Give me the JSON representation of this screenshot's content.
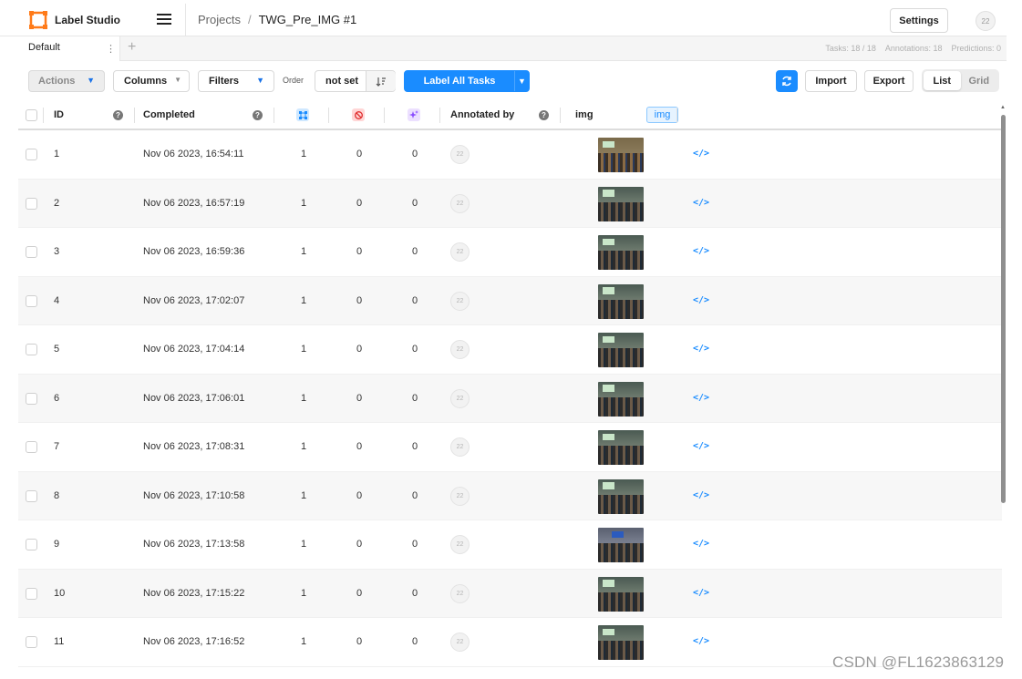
{
  "header": {
    "app_name": "Label Studio",
    "breadcrumb_root": "Projects",
    "breadcrumb_separator": "/",
    "project_name": "TWG_Pre_IMG #1",
    "settings_label": "Settings",
    "user_badge": "22",
    "brand_color": "#ff7a18"
  },
  "tabs": {
    "active_tab": "Default",
    "menu_glyph": "⋮",
    "add_glyph": "+",
    "stats": {
      "tasks": "Tasks: 18 / 18",
      "annotations": "Annotations: 18",
      "predictions": "Predictions: 0"
    }
  },
  "toolbar": {
    "actions_label": "Actions",
    "columns_label": "Columns",
    "filters_label": "Filters",
    "order_label": "Order",
    "order_value": "not set",
    "label_all_label": "Label All Tasks",
    "import_label": "Import",
    "export_label": "Export",
    "view_list": "List",
    "view_grid": "Grid",
    "accent_color": "#1a8cff"
  },
  "table": {
    "columns": {
      "id": "ID",
      "completed": "Completed",
      "total_annotations_icon": "annotations-count-icon",
      "cancelled_icon": "cancelled-icon",
      "predictions_icon": "predictions-icon",
      "annotated_by": "Annotated by",
      "data_column": "img",
      "data_tag": "img"
    },
    "rows": [
      {
        "id": "1",
        "completed": "Nov 06 2023, 16:54:11",
        "annotations": "1",
        "cancelled": "0",
        "predictions": "0",
        "annotator": "22",
        "source": "</>"
      },
      {
        "id": "2",
        "completed": "Nov 06 2023, 16:57:19",
        "annotations": "1",
        "cancelled": "0",
        "predictions": "0",
        "annotator": "22",
        "source": "</>"
      },
      {
        "id": "3",
        "completed": "Nov 06 2023, 16:59:36",
        "annotations": "1",
        "cancelled": "0",
        "predictions": "0",
        "annotator": "22",
        "source": "</>"
      },
      {
        "id": "4",
        "completed": "Nov 06 2023, 17:02:07",
        "annotations": "1",
        "cancelled": "0",
        "predictions": "0",
        "annotator": "22",
        "source": "</>"
      },
      {
        "id": "5",
        "completed": "Nov 06 2023, 17:04:14",
        "annotations": "1",
        "cancelled": "0",
        "predictions": "0",
        "annotator": "22",
        "source": "</>"
      },
      {
        "id": "6",
        "completed": "Nov 06 2023, 17:06:01",
        "annotations": "1",
        "cancelled": "0",
        "predictions": "0",
        "annotator": "22",
        "source": "</>"
      },
      {
        "id": "7",
        "completed": "Nov 06 2023, 17:08:31",
        "annotations": "1",
        "cancelled": "0",
        "predictions": "0",
        "annotator": "22",
        "source": "</>"
      },
      {
        "id": "8",
        "completed": "Nov 06 2023, 17:10:58",
        "annotations": "1",
        "cancelled": "0",
        "predictions": "0",
        "annotator": "22",
        "source": "</>"
      },
      {
        "id": "9",
        "completed": "Nov 06 2023, 17:13:58",
        "annotations": "1",
        "cancelled": "0",
        "predictions": "0",
        "annotator": "22",
        "source": "</>"
      },
      {
        "id": "10",
        "completed": "Nov 06 2023, 17:15:22",
        "annotations": "1",
        "cancelled": "0",
        "predictions": "0",
        "annotator": "22",
        "source": "</>"
      },
      {
        "id": "11",
        "completed": "Nov 06 2023, 17:16:52",
        "annotations": "1",
        "cancelled": "0",
        "predictions": "0",
        "annotator": "22",
        "source": "</>"
      }
    ]
  },
  "watermark": "CSDN @FL1623863129"
}
